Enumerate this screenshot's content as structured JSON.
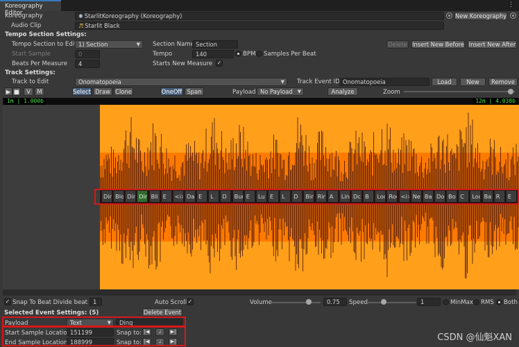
{
  "window": {
    "tab_title": "Koreography Editor"
  },
  "header": {
    "koreography_label": "Koreography",
    "koreography_value": "StarlitKoreography (Koreography)",
    "new_koreography_button": "New Koreography",
    "audio_clip_label": "Audio Clip",
    "audio_clip_value": "Starlit Black"
  },
  "tempo": {
    "section_title": "Tempo Section Settings:",
    "section_to_edit_label": "Tempo Section to Edit",
    "section_to_edit_value": "1) Section",
    "start_sample_label": "Start Sample",
    "start_sample_value": "0",
    "beats_per_measure_label": "Beats Per Measure",
    "beats_per_measure_value": "4",
    "section_name_label": "Section Name",
    "section_name_value": "Section",
    "tempo_label": "Tempo",
    "tempo_value": "140",
    "bpm_label": "BPM",
    "samples_per_beat_label": "Samples Per Beat",
    "starts_new_measure_label": "Starts New Measure",
    "delete_button": "Delete",
    "insert_before_button": "Insert New Before",
    "insert_after_button": "Insert New After"
  },
  "track": {
    "section_title": "Track Settings:",
    "track_to_edit_label": "Track to Edit",
    "track_to_edit_value": "Onomatopoeia",
    "track_event_id_label": "Track Event ID",
    "track_event_id_value": "Onomatopoeia",
    "load_button": "Load",
    "new_button": "New",
    "remove_button": "Remove"
  },
  "toolbar": {
    "play_icon": "play-icon",
    "stop_icon": "stop-icon",
    "v_button": "V",
    "m_button": "M",
    "select_button": "Select",
    "draw_button": "Draw",
    "clone_button": "Clone",
    "oneoff_button": "OneOff",
    "span_button": "Span",
    "payload_label": "Payload",
    "payload_value": "No Payload",
    "analyze_button": "Analyze",
    "zoom_label": "Zoom",
    "zoom_level": 0.96
  },
  "timeline": {
    "ruler_left": "1m | 1.000b",
    "ruler_right": "12m | 4.038b",
    "waveform_color": "#ff9f1a",
    "waveform_dark_color": "#ff7a00",
    "waveform_peak_color": "#3a1010",
    "events": [
      {
        "label": "Ding",
        "selected": false
      },
      {
        "label": "Blon Bling",
        "selected": false
      },
      {
        "label": "Dir Do",
        "selected": false
      },
      {
        "label": "Ding",
        "selected": true
      },
      {
        "label": "Bli",
        "selected": false
      },
      {
        "label": "E",
        "selected": false
      },
      {
        "label": "<i>E",
        "selected": false
      },
      {
        "label": "Da",
        "selected": false
      },
      {
        "label": "E",
        "selected": false
      },
      {
        "label": "L",
        "selected": false
      },
      {
        "label": "D",
        "selected": false
      },
      {
        "label": "Bun",
        "selected": false
      },
      {
        "label": "E",
        "selected": false
      },
      {
        "label": "Lu",
        "selected": false
      },
      {
        "label": "E",
        "selected": false
      },
      {
        "label": "L",
        "selected": false
      },
      {
        "label": "D",
        "selected": false
      },
      {
        "label": "Bin",
        "selected": false
      },
      {
        "label": "Rir",
        "selected": false
      },
      {
        "label": "A",
        "selected": false
      },
      {
        "label": "Ling",
        "selected": false
      },
      {
        "label": "Dc",
        "selected": false
      },
      {
        "label": "B",
        "selected": false
      },
      {
        "label": "Loo",
        "selected": false
      },
      {
        "label": "Roo",
        "selected": false
      },
      {
        "label": "<i>Too",
        "selected": false
      },
      {
        "label": "Ne",
        "selected": false
      },
      {
        "label": "Ba",
        "selected": false
      },
      {
        "label": "Doo",
        "selected": false
      },
      {
        "label": "Bo",
        "selected": false
      },
      {
        "label": "C",
        "selected": false
      },
      {
        "label": "Loo",
        "selected": false
      },
      {
        "label": "Ba",
        "selected": false
      },
      {
        "label": "R",
        "selected": false
      },
      {
        "label": "E",
        "selected": false
      }
    ]
  },
  "footer": {
    "snap_label": "Snap To Beat Divide beat by",
    "snap_value": "1",
    "auto_scroll_label": "Auto Scroll",
    "volume_label": "Volume",
    "volume_value": "0.75",
    "volume_level": 0.75,
    "speed_label": "Speed",
    "speed_value": "1",
    "speed_level": 0.33,
    "minmax_label": "MinMax",
    "rms_label": "RMS",
    "both_label": "Both",
    "selected_event_title": "Selected Event Settings: (5)",
    "delete_event_button": "Delete Event",
    "payload_label": "Payload",
    "payload_type_value": "Text",
    "payload_text_value": "Ding",
    "start_sample_label": "Start Sample Location",
    "start_sample_value": "151199",
    "end_sample_label": "End Sample Location",
    "end_sample_value": "188999",
    "snap_to_label": "Snap to:",
    "snap_to_label_2": "Snap to:"
  },
  "watermark": "CSDN @仙魁XAN"
}
